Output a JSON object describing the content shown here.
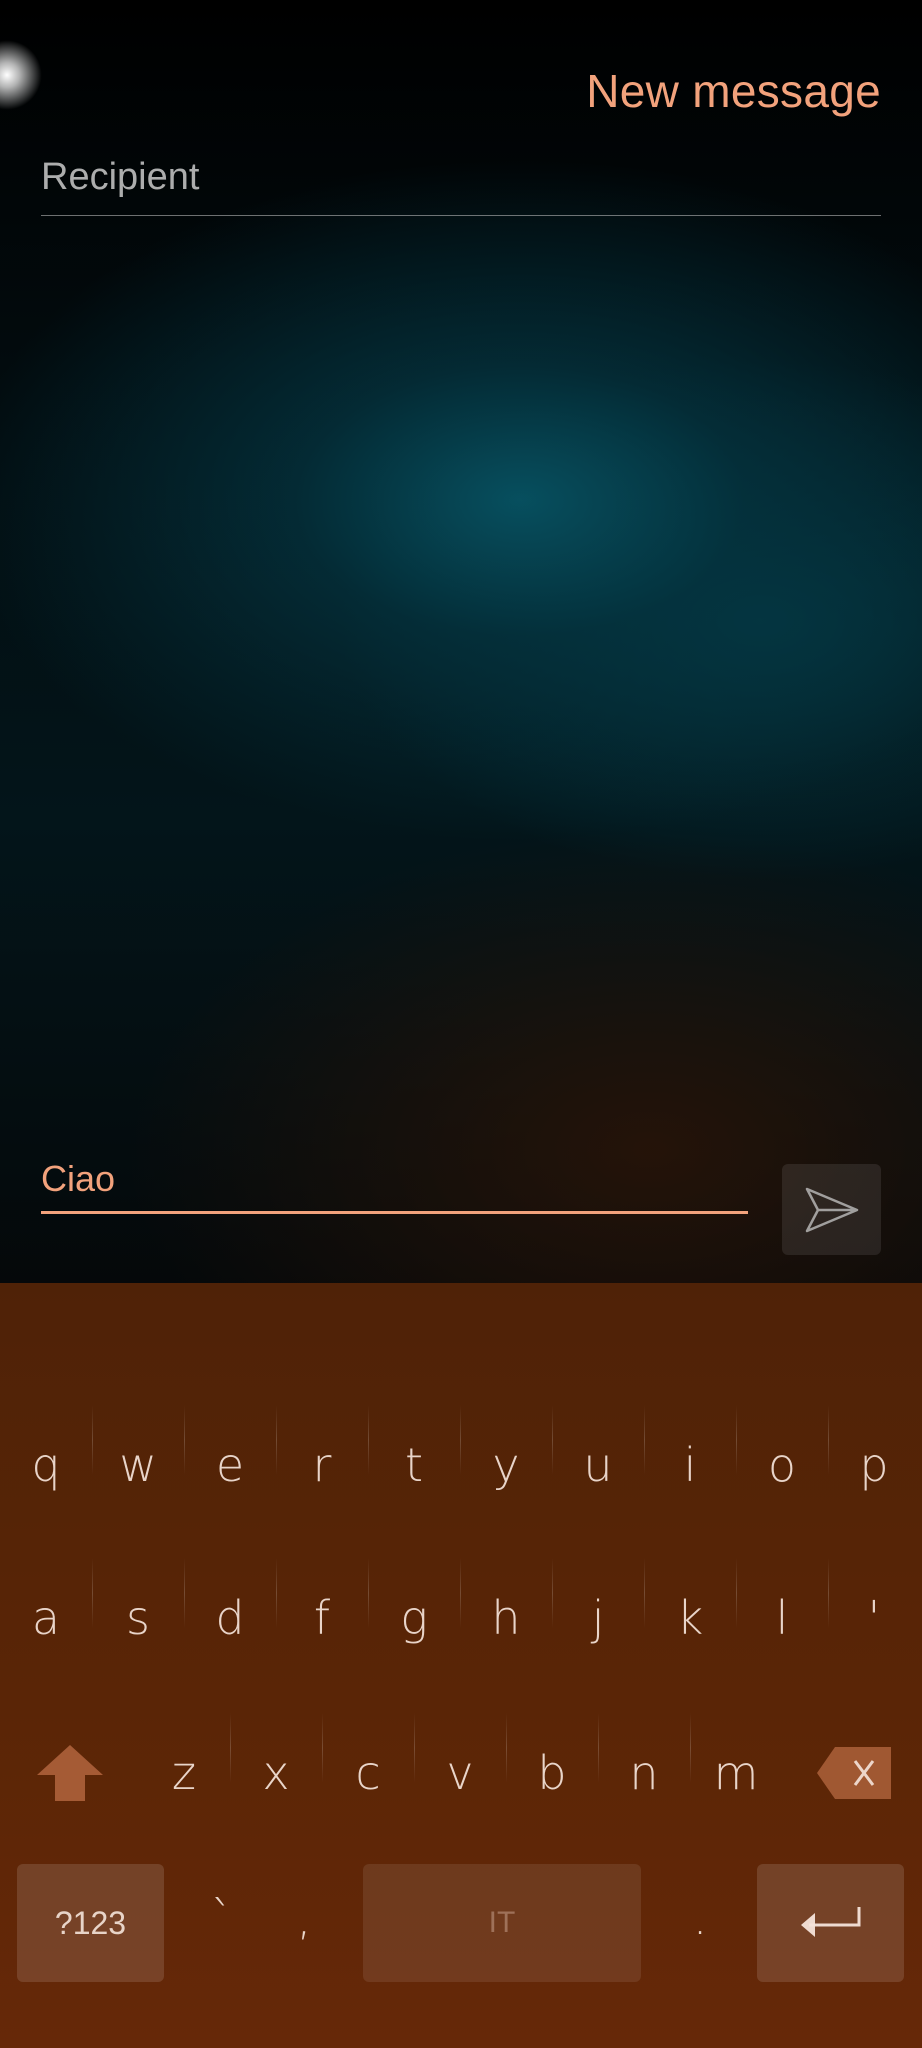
{
  "header": {
    "title": "New message"
  },
  "recipient": {
    "placeholder": "Recipient"
  },
  "composer": {
    "text": "Ciao",
    "send_icon": "send-icon"
  },
  "keyboard": {
    "row1": [
      "q",
      "w",
      "e",
      "r",
      "t",
      "y",
      "u",
      "i",
      "o",
      "p"
    ],
    "row2": [
      "a",
      "s",
      "d",
      "f",
      "g",
      "h",
      "j",
      "k",
      "l",
      "'"
    ],
    "row3": [
      "z",
      "x",
      "c",
      "v",
      "b",
      "n",
      "m"
    ],
    "shift_icon": "shift-arrow-icon",
    "backspace_icon": "backspace-icon",
    "symbols_label": "?123",
    "backtick": "`",
    "comma": ",",
    "space_label": "IT",
    "period": ".",
    "enter_icon": "enter-icon"
  },
  "colors": {
    "accent": "#f2a27c",
    "keyboard_bg": "#5a2506"
  }
}
